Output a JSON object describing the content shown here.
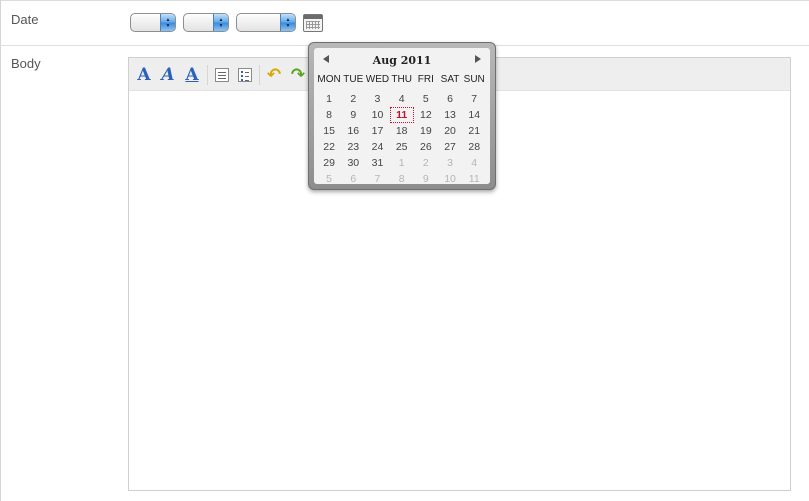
{
  "form": {
    "date_label": "Date",
    "body_label": "Body"
  },
  "date_selects": {
    "month_value": "",
    "day_value": "",
    "year_value": ""
  },
  "editor": {
    "toolbar": [
      {
        "name": "font-size-button",
        "icon": "font-a-icon",
        "glyph": "A"
      },
      {
        "name": "font-style-button",
        "icon": "font-italic-icon",
        "glyph": "A"
      },
      {
        "name": "font-underline-button",
        "icon": "font-underline-icon",
        "glyph": "A"
      },
      {
        "name": "numbered-list-button",
        "icon": "numbered-list-icon"
      },
      {
        "name": "bullet-list-button",
        "icon": "bullet-list-icon"
      },
      {
        "name": "undo-button",
        "icon": "undo-icon",
        "glyph": "↶"
      },
      {
        "name": "redo-button",
        "icon": "redo-icon",
        "glyph": "↷"
      }
    ],
    "content": ""
  },
  "datepicker": {
    "title": "Aug 2011",
    "weekdays": [
      "MON",
      "TUE",
      "WED",
      "THU",
      "FRI",
      "SAT",
      "SUN"
    ],
    "weeks": [
      [
        "1",
        "2",
        "3",
        "4",
        "5",
        "6",
        "7"
      ],
      [
        "8",
        "9",
        "10",
        "11",
        "12",
        "13",
        "14"
      ],
      [
        "15",
        "16",
        "17",
        "18",
        "19",
        "20",
        "21"
      ],
      [
        "22",
        "23",
        "24",
        "25",
        "26",
        "27",
        "28"
      ],
      [
        "29",
        "30",
        "31",
        "1",
        "2",
        "3",
        "4"
      ],
      [
        "5",
        "6",
        "7",
        "8",
        "9",
        "10",
        "11"
      ]
    ],
    "other_month": [
      [
        4,
        3
      ],
      [
        4,
        4
      ],
      [
        4,
        5
      ],
      [
        4,
        6
      ],
      [
        5,
        0
      ],
      [
        5,
        1
      ],
      [
        5,
        2
      ],
      [
        5,
        3
      ],
      [
        5,
        4
      ],
      [
        5,
        5
      ],
      [
        5,
        6
      ]
    ],
    "today": [
      1,
      3
    ],
    "today_color": "#c8102e",
    "other_month_color": "#b5b5b5"
  }
}
